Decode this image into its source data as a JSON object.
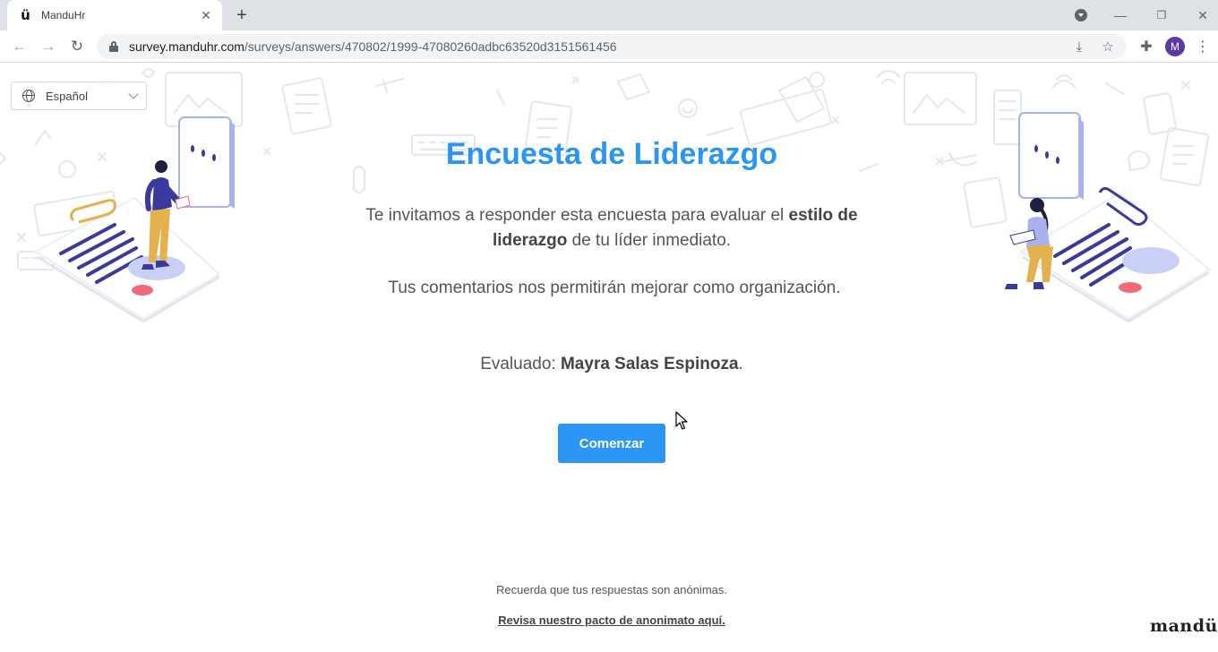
{
  "browser": {
    "tab_title": "ManduHr",
    "tab_favicon": "ü",
    "url_host": "survey.manduhr.com",
    "url_path": "/surveys/answers/470802/1999-47080260adbc63520d3151561456",
    "profile_initial": "M"
  },
  "page": {
    "language": "Español",
    "title": "Encuesta de Liderazgo",
    "intro_before": "Te invitamos a responder esta encuesta para evaluar el ",
    "intro_bold": "estilo de liderazgo",
    "intro_after": " de tu líder inmediato.",
    "intro2": "Tus comentarios nos permitirán mejorar como organización.",
    "evaluated_label": "Evaluado: ",
    "evaluated_name": "Mayra Salas Espinoza",
    "evaluated_end": ".",
    "start_button": "Comenzar",
    "anon_note": "Recuerda que tus respuestas son anónimas.",
    "pact_link": "Revisa nuestro pacto de anonimato aquí.",
    "brand": "mandü"
  },
  "colors": {
    "accent": "#2a95f4",
    "button": "#2b96f5",
    "illustration_purple": "#3a3a9e",
    "illustration_yellow": "#e3b24f",
    "illustration_pink": "#ef6b7a"
  },
  "icons": [
    "globe-icon",
    "chevron-down-icon",
    "lock-icon",
    "reload-icon",
    "back-arrow-icon",
    "forward-arrow-icon",
    "star-icon",
    "extensions-icon",
    "install-icon",
    "close-icon",
    "plus-icon",
    "cursor-icon"
  ]
}
